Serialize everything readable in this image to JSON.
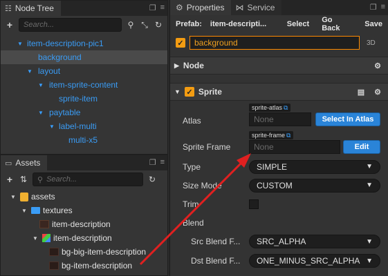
{
  "node_tree": {
    "tab_label": "Node Tree",
    "search_placeholder": "Search...",
    "items": [
      {
        "label": "item-description-pic1",
        "expanded": true
      },
      {
        "label": "background",
        "selected": true
      },
      {
        "label": "layout",
        "expanded": true
      },
      {
        "label": "item-sprite-content",
        "expanded": true
      },
      {
        "label": "sprite-item"
      },
      {
        "label": "paytable",
        "expanded": true
      },
      {
        "label": "label-multi",
        "expanded": true
      },
      {
        "label": "multi-x5"
      }
    ]
  },
  "assets": {
    "tab_label": "Assets",
    "search_placeholder": "Search...",
    "items": [
      {
        "label": "assets"
      },
      {
        "label": "textures"
      },
      {
        "label": "item-description"
      },
      {
        "label": "item-description"
      },
      {
        "label": "bg-big-item-description"
      },
      {
        "label": "bg-item-description"
      }
    ]
  },
  "inspector": {
    "tabs": [
      {
        "label": "Properties"
      },
      {
        "label": "Service"
      }
    ],
    "prefab": {
      "label": "Prefab:",
      "name": "item-descripti...",
      "select": "Select",
      "go_back": "Go Back",
      "save": "Save"
    },
    "node_name": "background",
    "node_3d": "3D",
    "sections": {
      "node": "Node",
      "sprite": "Sprite"
    },
    "sprite": {
      "atlas": {
        "label": "Atlas",
        "tag": "sprite-atlas",
        "value": "None",
        "button": "Select In Atlas"
      },
      "sprite_frame": {
        "label": "Sprite Frame",
        "tag": "sprite-frame",
        "value": "None",
        "button": "Edit"
      },
      "type": {
        "label": "Type",
        "value": "SIMPLE"
      },
      "size_mode": {
        "label": "Size Mode",
        "value": "CUSTOM"
      },
      "trim": {
        "label": "Trim",
        "checked": false
      },
      "blend": {
        "label": "Blend"
      },
      "src_blend": {
        "label": "Src Blend F...",
        "value": "SRC_ALPHA"
      },
      "dst_blend": {
        "label": "Dst Blend F...",
        "value": "ONE_MINUS_SRC_ALPHA"
      }
    }
  },
  "colors": {
    "accent_orange": "#ff8a00",
    "node_blue": "#3a9cf5",
    "button_blue": "#2a84d8",
    "arrow_red": "#e02020"
  }
}
